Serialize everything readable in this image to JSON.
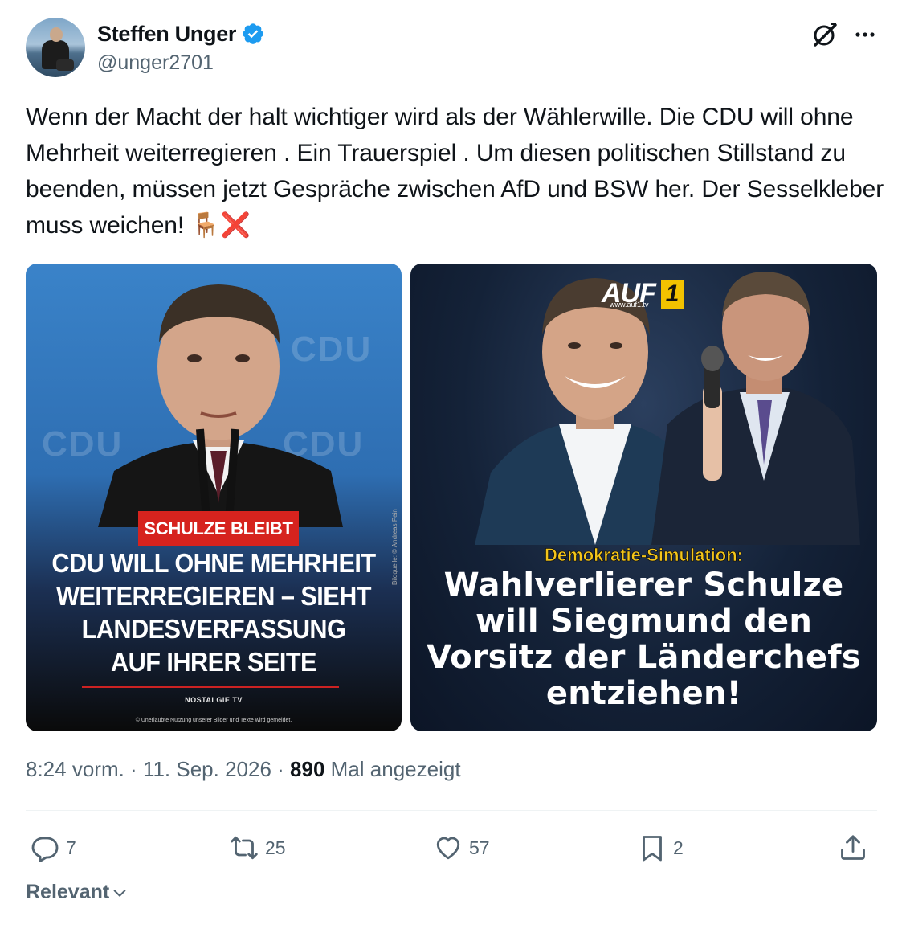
{
  "author": {
    "display_name": "Steffen Unger",
    "handle": "@unger2701"
  },
  "tweet": {
    "text": "Wenn der Macht der halt wichtiger wird als der Wählerwille. Die CDU will ohne Mehrheit weiterregieren . Ein Trauerspiel . Um diesen politischen Stillstand zu beenden, müssen jetzt Gespräche zwischen AfD und BSW her. Der Sesselkleber muss weichen! 🪑❌"
  },
  "media_left": {
    "background_text": "CDU",
    "badge": "SCHULZE BLEIBT",
    "headline_lines": [
      "CDU WILL OHNE MEHRHEIT",
      "WEITERREGIEREN – SIEHT",
      "LANDESVERFASSUNG",
      "AUF IHRER SEITE"
    ],
    "source": "NOSTALGIE TV",
    "copyright": "© Unerlaubte Nutzung unserer Bilder und Texte wird gemeldet.",
    "credit": "Bildquelle: © Andreas Pein"
  },
  "media_right": {
    "logo_text": "AUF",
    "logo_number": "1",
    "logo_url": "www.auf1.tv",
    "kicker": "Demokratie-Simulation:",
    "headline_lines": [
      "Wahlverlierer Schulze",
      "will Siegmund den",
      "Vorsitz der Länderchefs",
      "entziehen!"
    ]
  },
  "meta": {
    "time": "8:24 vorm.",
    "separator": " · ",
    "date": "11. Sep. 2026",
    "views_count": "890",
    "views_label": " Mal angezeigt"
  },
  "actions": {
    "replies": "7",
    "reposts": "25",
    "likes": "57",
    "bookmarks": "2"
  },
  "sort": {
    "label": "Relevant"
  },
  "colors": {
    "verified": "#1d9bf0",
    "secondary_text": "#536471",
    "primary_text": "#0f1419",
    "badge_red": "#d6231e",
    "kicker_yellow": "#f3c51b"
  },
  "icons": [
    "verified-badge-icon",
    "grok-icon",
    "more-icon",
    "reply-icon",
    "repost-icon",
    "like-icon",
    "bookmark-icon",
    "share-icon",
    "chevron-down-icon"
  ]
}
